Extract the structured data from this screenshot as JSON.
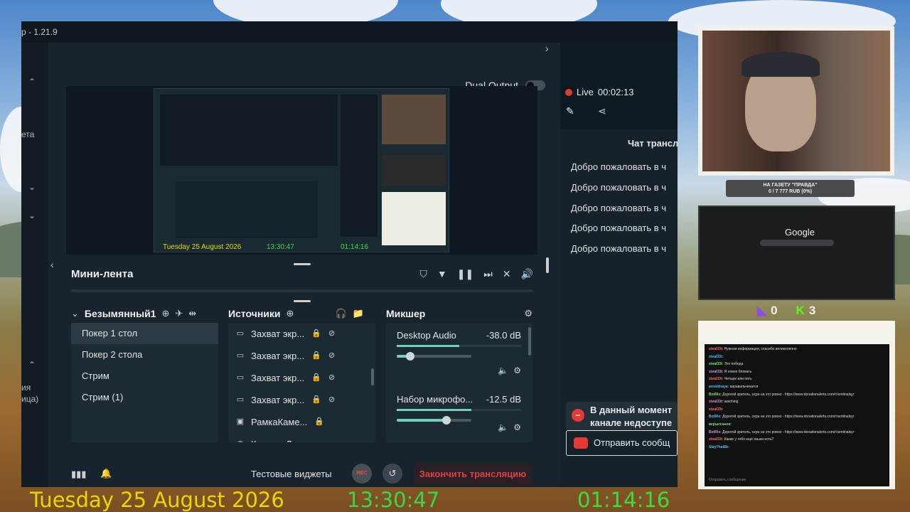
{
  "window": {
    "title_fragment": "p - 1.21.9"
  },
  "left_nav": {
    "labels": [
      "ета",
      "ия",
      "ица)"
    ]
  },
  "top": {
    "dual_output_label": "Dual Output"
  },
  "preview": {
    "nested_date": "Tuesday 25 August 2026",
    "nested_time": "13:30:47",
    "nested_timer": "01:14:16"
  },
  "mini_feed": {
    "title": "Мини-лента"
  },
  "scenes": {
    "collection_name": "Безымянный1",
    "items": [
      "Покер 1 стол",
      "Покер 2 стола",
      "Стрим",
      "Стрим (1)"
    ],
    "selected_index": 0
  },
  "sources": {
    "title": "Источники",
    "items": [
      "Захват экр...",
      "Захват экр...",
      "Захват экр...",
      "Захват экр...",
      "РамкаКаме...",
      "Камера Лог..."
    ]
  },
  "mixer": {
    "title": "Микшер",
    "channels": [
      {
        "name": "Desktop Audio",
        "db": "-38.0 dB",
        "volume": 0.18,
        "meter": 0.5
      },
      {
        "name": "Набор микрофо...",
        "db": "-12.5 dB",
        "volume": 0.67,
        "meter": 0.6
      }
    ]
  },
  "footer": {
    "widgets_label": "Тестовые виджеты",
    "rec_label": "REC",
    "end_stream_label": "Закончить трансляцию"
  },
  "right_panel": {
    "live_label": "Live",
    "live_time": "00:02:13",
    "chat_header": "Чат трансл",
    "messages": [
      "Добро пожаловать в ч",
      "Добро пожаловать в ч",
      "Добро пожаловать в ч",
      "Добро пожаловать в ч",
      "Добро пожаловать в ч"
    ],
    "notice_line1": "В данный момент",
    "notice_line2": "канале недоступе",
    "send_label": "Отправить сообщ"
  },
  "overlay": {
    "date": "Tuesday 25 August 2026",
    "time": "13:30:47",
    "timer": "01:14:16",
    "donation_title": "НА ГАЗЕТУ \"ПРАВДА\"",
    "donation_progress": "0 / 7 777 RUB (0%)",
    "google_label": "Google",
    "twitch_count": "0",
    "kick_count": "3",
    "chat_lines": [
      {
        "user": "steal33t",
        "text": "Нужная информация, спасибо великолепно"
      },
      {
        "user": "steal33t",
        "text": ""
      },
      {
        "user": "steal33t",
        "text": "Это победа"
      },
      {
        "user": "steal33t",
        "text": "Я новое блевать"
      },
      {
        "user": "steal33t",
        "text": "Четыре или пять"
      },
      {
        "user": "arnoldnaya",
        "text": "варавальчичатся"
      },
      {
        "user": "BotRix",
        "text": "Дорогой зритель, охра на это ровно - https://www.donationalerts.com/r/sentinalsyr"
      },
      {
        "user": "steal33t",
        "text": "watching"
      },
      {
        "user": "steal33t",
        "text": ""
      },
      {
        "user": "BotRix",
        "text": "Дорогой зритель, охра на это ровно - https://www.donationalerts.com/r/sentinalsyr"
      },
      {
        "user": "верыссанок",
        "text": ""
      },
      {
        "user": "BotRix",
        "text": "Дорогой зритель, охра на это ровно - https://www.donationalerts.com/r/sentinalsyr"
      },
      {
        "user": "steal33t",
        "text": "Какие у тебя ещё языки есть?"
      },
      {
        "user": "StayThat8b",
        "text": ""
      }
    ],
    "chat_input_placeholder": "Отправить сообщение"
  },
  "colors": {
    "accent_red": "#e53935",
    "meter_green": "#6fd1b8",
    "clock_date": "#e6d900",
    "clock_time": "#39d84a",
    "clock_timer": "#3ddc3d"
  }
}
